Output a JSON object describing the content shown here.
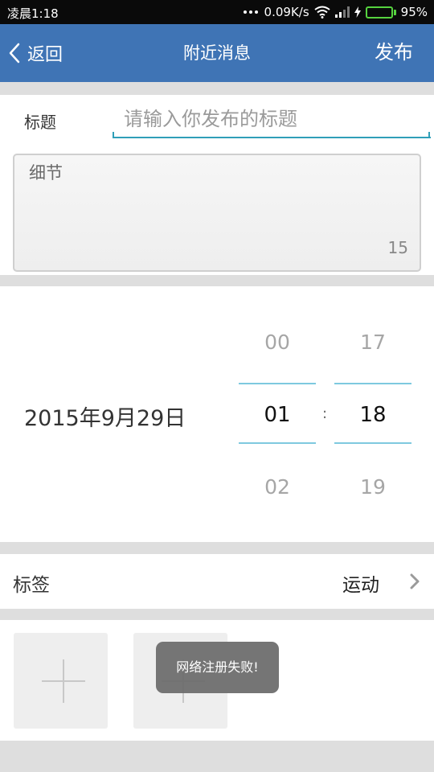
{
  "status_bar": {
    "time": "凌晨1:18",
    "network_speed": "0.09K/s",
    "battery_percent": "95%",
    "battery_level": 0.95,
    "icons": [
      "more-dots-icon",
      "wifi-icon",
      "signal-icon",
      "charging-bolt-icon",
      "battery-icon"
    ],
    "battery_color": "#56d33f"
  },
  "nav": {
    "back_label": "返回",
    "title": "附近消息",
    "publish_label": "发布",
    "background_color": "#3f74b5"
  },
  "form": {
    "title_label": "标题",
    "title_placeholder": "请输入你发布的标题",
    "title_value": "",
    "detail_placeholder": "细节",
    "detail_value": "",
    "char_count": "15",
    "accent_color": "#2f9fb8"
  },
  "date_time": {
    "date": "2015年9月29日",
    "separator": ":",
    "hour": {
      "prev": "00",
      "current": "01",
      "next": "02"
    },
    "minute": {
      "prev": "17",
      "current": "18",
      "next": "19"
    }
  },
  "tag": {
    "label": "标签",
    "value": "运动"
  },
  "photos": {
    "slots": 2,
    "icon": "plus-icon"
  },
  "toast": {
    "message": "网络注册失败!"
  }
}
